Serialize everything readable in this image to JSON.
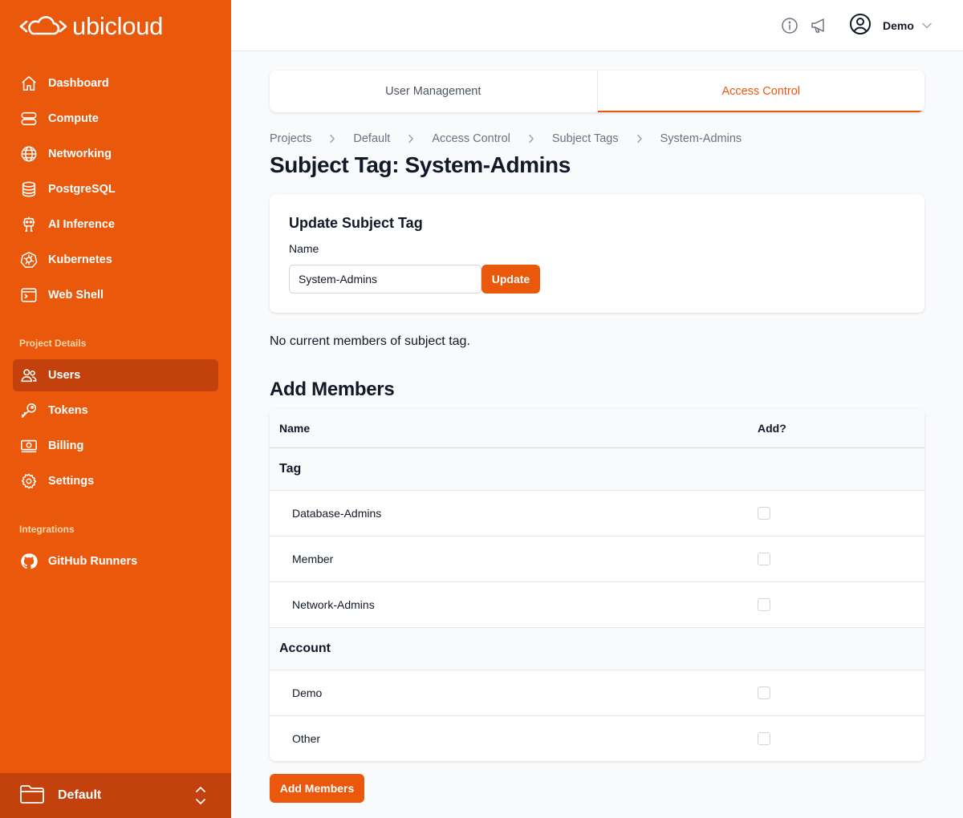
{
  "brand": {
    "name": "ubicloud",
    "primary_color": "#ea580c",
    "active_color": "#c2410c"
  },
  "sidebar": {
    "items": [
      {
        "label": "Dashboard",
        "icon": "home-icon"
      },
      {
        "label": "Compute",
        "icon": "server-icon"
      },
      {
        "label": "Networking",
        "icon": "globe-icon"
      },
      {
        "label": "PostgreSQL",
        "icon": "database-icon"
      },
      {
        "label": "AI Inference",
        "icon": "robot-icon"
      },
      {
        "label": "Kubernetes",
        "icon": "kubernetes-icon"
      },
      {
        "label": "Web Shell",
        "icon": "terminal-icon"
      }
    ],
    "project_details_label": "Project Details",
    "project_items": [
      {
        "label": "Users",
        "icon": "users-icon",
        "active": true
      },
      {
        "label": "Tokens",
        "icon": "key-icon"
      },
      {
        "label": "Billing",
        "icon": "banknote-icon"
      },
      {
        "label": "Settings",
        "icon": "gear-icon"
      }
    ],
    "integrations_label": "Integrations",
    "integration_items": [
      {
        "label": "GitHub Runners",
        "icon": "github-icon"
      }
    ],
    "project_switcher": {
      "label": "Default",
      "icon": "folder-icon"
    }
  },
  "topbar": {
    "user_name": "Demo",
    "icons": [
      "info-icon",
      "megaphone-icon",
      "user-circle-icon"
    ]
  },
  "tabs": [
    {
      "label": "User Management",
      "active": false
    },
    {
      "label": "Access Control",
      "active": true
    }
  ],
  "breadcrumb": [
    "Projects",
    "Default",
    "Access Control",
    "Subject Tags",
    "System-Admins"
  ],
  "page_title": "Subject Tag: System-Admins",
  "update_card": {
    "title": "Update Subject Tag",
    "name_label": "Name",
    "name_value": "System-Admins",
    "button_label": "Update"
  },
  "empty_members_text": "No current members of subject tag.",
  "add_members": {
    "title": "Add Members",
    "columns": [
      "Name",
      "Add?"
    ],
    "groups": [
      {
        "label": "Tag",
        "items": [
          "Database-Admins",
          "Member",
          "Network-Admins"
        ]
      },
      {
        "label": "Account",
        "items": [
          "Demo",
          "Other"
        ]
      }
    ],
    "button_label": "Add Members"
  }
}
